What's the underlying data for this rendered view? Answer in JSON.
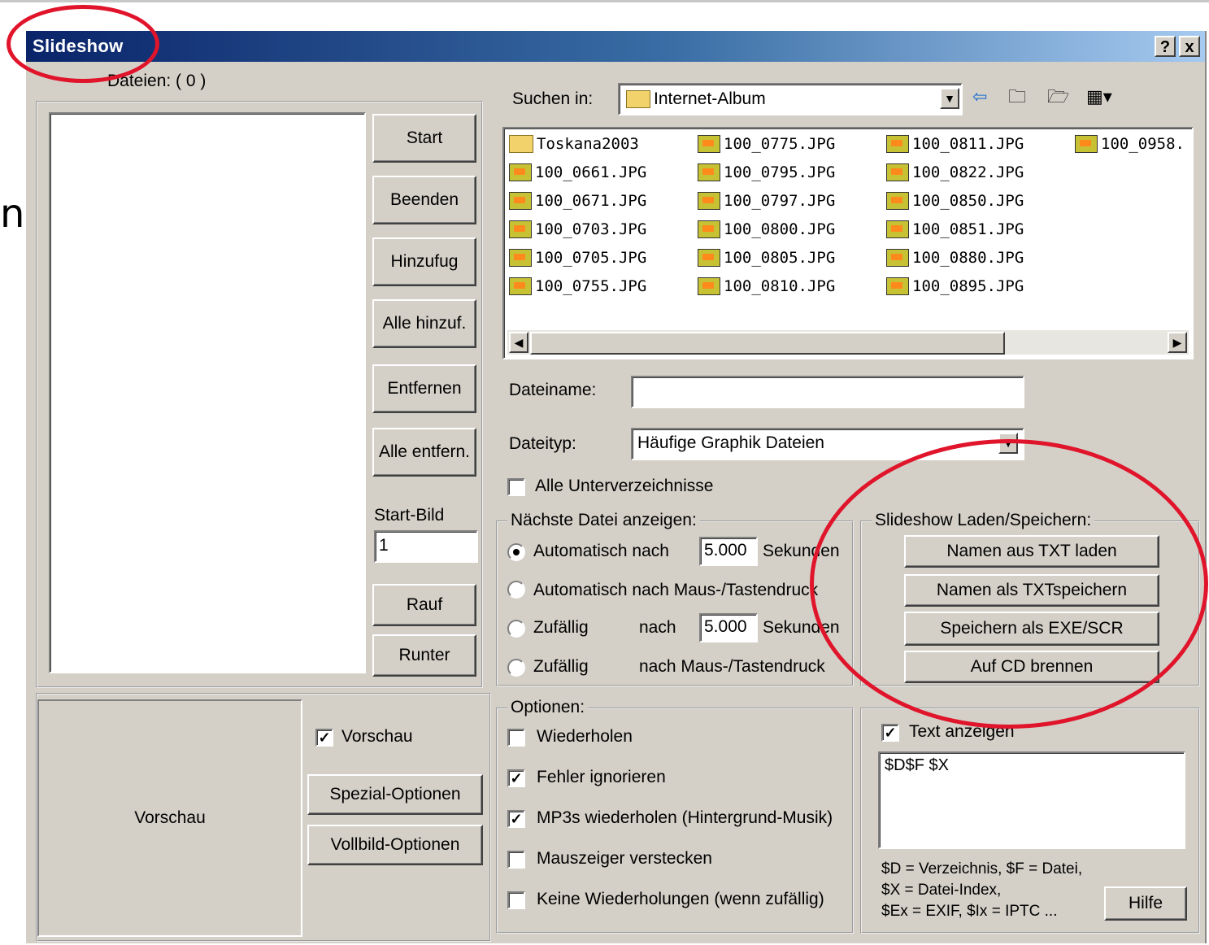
{
  "window": {
    "title": "Slideshow",
    "help_btn": "?",
    "close_btn": "x"
  },
  "edge_fragment": "n",
  "files_header": "Dateien: ( 0 )",
  "left_buttons": {
    "start": "Start",
    "beenden": "Beenden",
    "hinzufug": "Hinzufug",
    "alle_hinzu": "Alle hinzuf.",
    "entfernen": "Entfernen",
    "alle_entfern": "Alle entfern.",
    "rauf": "Rauf",
    "runter": "Runter"
  },
  "start_bild": {
    "label": "Start-Bild",
    "value": "1"
  },
  "look_in": {
    "label": "Suchen in:",
    "value": "Internet-Album"
  },
  "file_list": [
    {
      "name": "Toskana2003",
      "type": "folder"
    },
    {
      "name": "100_0661.JPG",
      "type": "jpg"
    },
    {
      "name": "100_0671.JPG",
      "type": "jpg"
    },
    {
      "name": "100_0703.JPG",
      "type": "jpg"
    },
    {
      "name": "100_0705.JPG",
      "type": "jpg"
    },
    {
      "name": "100_0755.JPG",
      "type": "jpg"
    },
    {
      "name": "100_0775.JPG",
      "type": "jpg"
    },
    {
      "name": "100_0795.JPG",
      "type": "jpg"
    },
    {
      "name": "100_0797.JPG",
      "type": "jpg"
    },
    {
      "name": "100_0800.JPG",
      "type": "jpg"
    },
    {
      "name": "100_0805.JPG",
      "type": "jpg"
    },
    {
      "name": "100_0810.JPG",
      "type": "jpg"
    },
    {
      "name": "100_0811.JPG",
      "type": "jpg"
    },
    {
      "name": "100_0822.JPG",
      "type": "jpg"
    },
    {
      "name": "100_0850.JPG",
      "type": "jpg"
    },
    {
      "name": "100_0851.JPG",
      "type": "jpg"
    },
    {
      "name": "100_0880.JPG",
      "type": "jpg"
    },
    {
      "name": "100_0895.JPG",
      "type": "jpg"
    },
    {
      "name": "100_0958.",
      "type": "jpg"
    }
  ],
  "dateiname": {
    "label": "Dateiname:",
    "value": ""
  },
  "dateityp": {
    "label": "Dateityp:",
    "value": "Häufige Graphik Dateien"
  },
  "alle_unterverzeichnisse": {
    "label": "Alle Unterverzeichnisse",
    "checked": false
  },
  "next_file": {
    "title": "Nächste Datei anzeigen:",
    "opt1": "Automatisch nach",
    "opt1_value": "5.000",
    "opt1_unit": "Sekunden",
    "opt2": "Automatisch nach Maus-/Tastendruck",
    "opt3": "Zufällig",
    "opt3_nach": "nach",
    "opt3_value": "5.000",
    "opt3_unit": "Sekunden",
    "opt4": "Zufällig",
    "opt4_rest": "nach Maus-/Tastendruck",
    "selected": 1
  },
  "load_save": {
    "title": "Slideshow Laden/Speichern:",
    "btn1": "Namen aus TXT laden",
    "btn2": "Namen als TXTspeichern",
    "btn3": "Speichern als EXE/SCR",
    "btn4": "Auf CD brennen"
  },
  "preview": {
    "label": "Vorschau",
    "checkbox": "Vorschau",
    "checked": true,
    "special": "Spezial-Optionen",
    "fullscreen": "Vollbild-Optionen"
  },
  "options": {
    "title": "Optionen:",
    "o1": "Wiederholen",
    "o2": "Fehler ignorieren",
    "o3": "MP3s wiederholen (Hintergrund-Musik)",
    "o4": "Mauszeiger verstecken",
    "o5": "Keine Wiederholungen (wenn zufällig)",
    "o1_checked": false,
    "o2_checked": true,
    "o3_checked": true,
    "o4_checked": false,
    "o5_checked": false
  },
  "text_display": {
    "label": "Text anzeigen",
    "checked": true,
    "value": "$D$F $X",
    "help1": "$D = Verzeichnis, $F = Datei,",
    "help2": "$X = Datei-Index,",
    "help3": "$Ex = EXIF, $Ix = IPTC ...",
    "hilfe": "Hilfe"
  },
  "colors": {
    "dialog": "#d4d0c8",
    "title_start": "#0a246a",
    "title_end": "#a6caf0",
    "annotation": "#e0142a"
  }
}
